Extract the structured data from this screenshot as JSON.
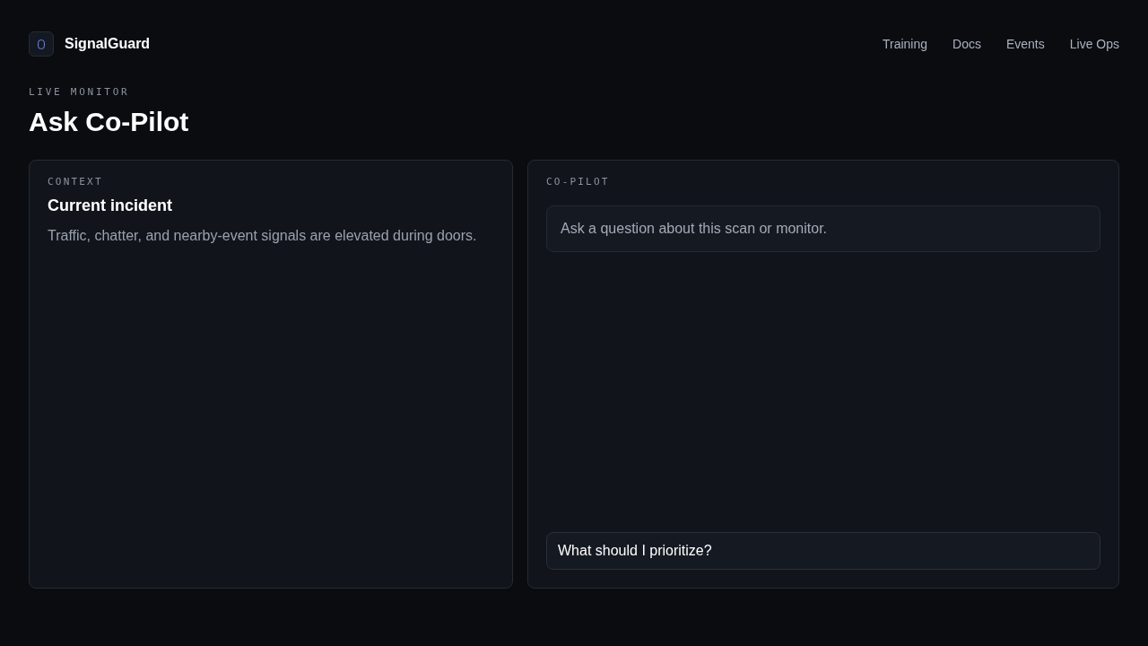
{
  "brand": {
    "name": "SignalGuard"
  },
  "nav": [
    {
      "label": "Training"
    },
    {
      "label": "Docs"
    },
    {
      "label": "Events"
    },
    {
      "label": "Live Ops"
    }
  ],
  "page": {
    "eyebrow": "LIVE MONITOR",
    "title": "Ask Co-Pilot"
  },
  "context_panel": {
    "label": "CONTEXT",
    "title": "Current incident",
    "description": "Traffic, chatter, and nearby-event signals are elevated during doors."
  },
  "copilot_panel": {
    "label": "CO-PILOT",
    "empty_message": "Ask a question about this scan or monitor.",
    "input": {
      "value": "What should I prioritize?"
    }
  }
}
